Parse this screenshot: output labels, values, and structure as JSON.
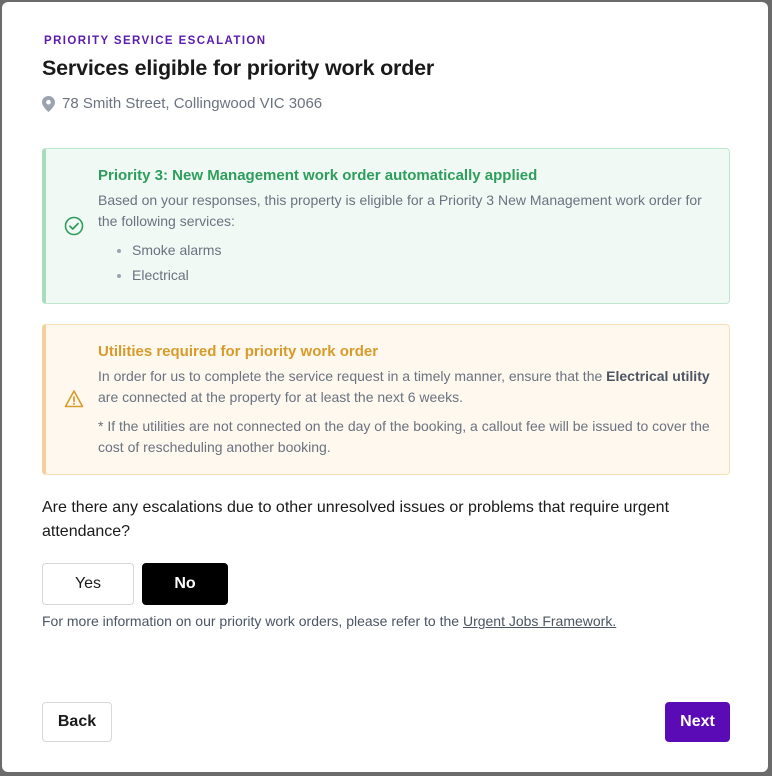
{
  "header": {
    "eyebrow": "PRIORITY SERVICE ESCALATION",
    "title": "Services eligible for priority work order",
    "address": "78 Smith Street, Collingwood VIC 3066",
    "address_icon": "map-pin-icon"
  },
  "priority_panel": {
    "icon": "check-circle-icon",
    "heading": "Priority 3: New Management work order automatically applied",
    "body": "Based on your responses, this property is eligible for a Priority 3 New Management work order for the following services:",
    "services": [
      "Smoke alarms",
      "Electrical"
    ]
  },
  "utilities_panel": {
    "icon": "warning-triangle-icon",
    "heading": "Utilities required for priority work order",
    "body_prefix": "In order for us to complete the service request in a timely manner, ensure that the ",
    "body_bold": "Electrical utility",
    "body_suffix": " are connected at the property for at least the next 6 weeks.",
    "note": "* If the utilities are not connected on the day of the booking, a callout fee will be issued to cover the cost of rescheduling another booking."
  },
  "escalation": {
    "question": "Are there any escalations due to other unresolved issues or problems that require urgent attendance?",
    "yes_label": "Yes",
    "no_label": "No",
    "selected": "No",
    "info_prefix": "For more information on our priority work orders, please refer to the ",
    "info_link": "Urgent Jobs Framework."
  },
  "footer": {
    "back_label": "Back",
    "next_label": "Next"
  },
  "colors": {
    "accent": "#5a0bb5",
    "success": "#2e9e5c",
    "warning": "#d89b2b"
  }
}
